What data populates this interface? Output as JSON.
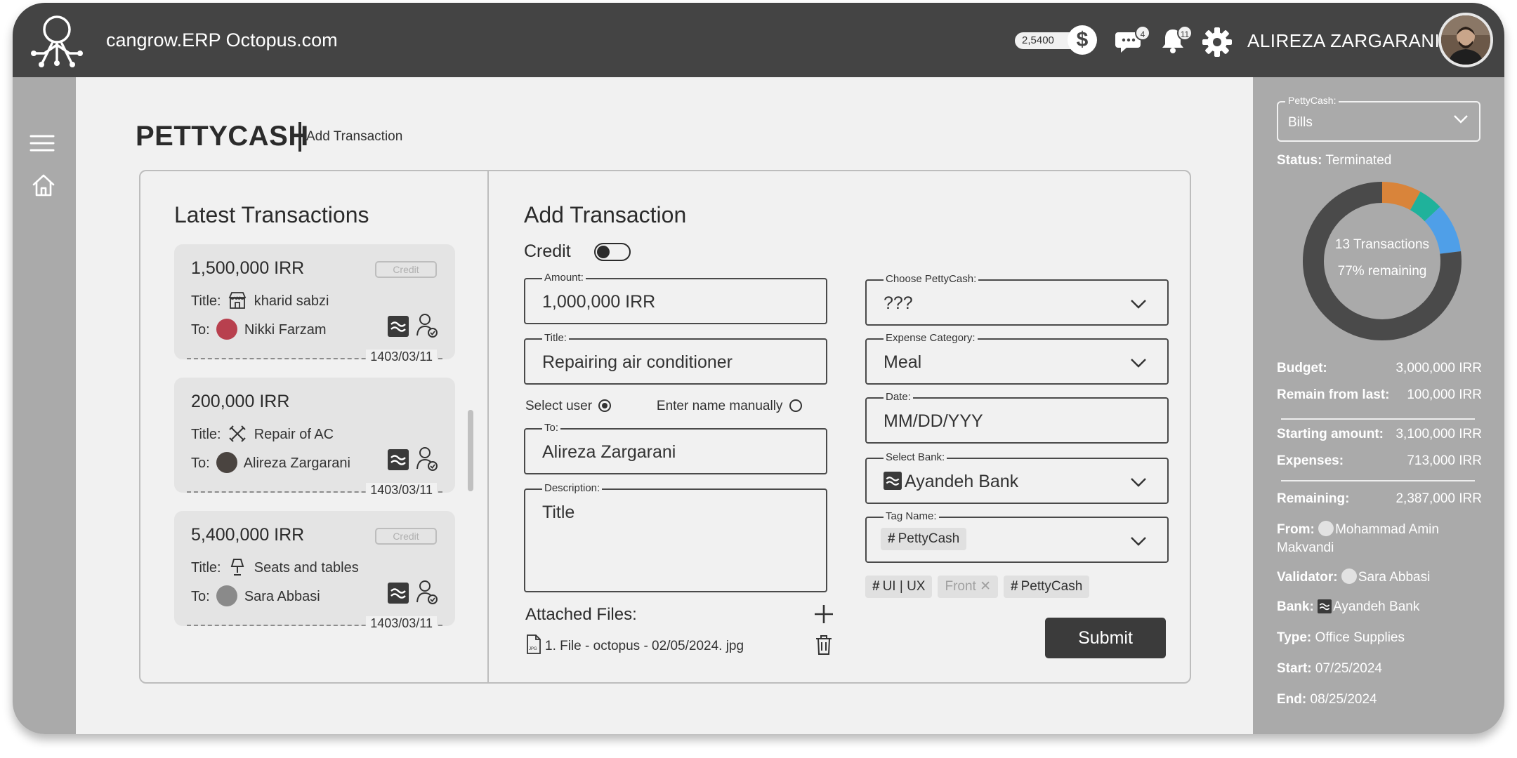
{
  "header": {
    "app_title": "cangrow.ERP Octopus.com",
    "balance": "2,5400",
    "messages_count": "4",
    "notifications_count": "11",
    "user_name": "ALIREZA ZARGARANI"
  },
  "page": {
    "title": "PETTYCASH",
    "subtitle": "Add Transaction"
  },
  "latest": {
    "title": "Latest Transactions",
    "items": [
      {
        "amount": "1,500,000 IRR",
        "badge": "Credit",
        "title_label": "Title:",
        "title": "kharid sabzi",
        "to_label": "To:",
        "to": "Nikki Farzam",
        "date": "1403/03/11",
        "title_icon": "store-icon",
        "avatar_color": "#b8404e"
      },
      {
        "amount": "200,000 IRR",
        "badge": "",
        "title_label": "Title:",
        "title": "Repair of AC",
        "to_label": "To:",
        "to": "Alireza Zargarani",
        "date": "1403/03/11",
        "title_icon": "tools-icon",
        "avatar_color": "#4a4440"
      },
      {
        "amount": "5,400,000 IRR",
        "badge": "Credit",
        "title_label": "Title:",
        "title": "Seats and tables",
        "to_label": "To:",
        "to": "Sara Abbasi",
        "date": "1403/03/11",
        "title_icon": "lamp-icon",
        "avatar_color": "#8a8a8a"
      }
    ]
  },
  "form": {
    "title": "Add Transaction",
    "credit_label": "Credit",
    "amount": {
      "label": "Amount:",
      "value": "1,000,000 IRR"
    },
    "title_field": {
      "label": "Title:",
      "value": "Repairing air conditioner"
    },
    "select_user_label": "Select user",
    "enter_manually_label": "Enter name manually",
    "to": {
      "label": "To:",
      "value": "Alireza Zargarani"
    },
    "description": {
      "label": "Description:",
      "value": "Title"
    },
    "pettycash": {
      "label": "Choose PettyCash:",
      "value": "???"
    },
    "category": {
      "label": "Expense Category:",
      "value": "Meal"
    },
    "date": {
      "label": "Date:",
      "value": "MM/DD/YYY"
    },
    "bank": {
      "label": "Select Bank:",
      "value": "Ayandeh Bank"
    },
    "tag": {
      "label": "Tag Name:",
      "value": "PettyCash"
    },
    "tags": [
      "UI | UX",
      "Front",
      "PettyCash"
    ],
    "attached_title": "Attached Files:",
    "file_name": "1. File - octopus - 02/05/2024. jpg",
    "submit_label": "Submit"
  },
  "sidebar": {
    "pettycash_label": "PettyCash:",
    "pettycash_value": "Bills",
    "status_label": "Status:",
    "status_value": "Terminated",
    "donut_line1": "13 Transactions",
    "donut_line2": "77% remaining",
    "donut_segments": [
      {
        "label": "orange",
        "fraction": 0.08,
        "color": "#d9843a"
      },
      {
        "label": "teal",
        "fraction": 0.05,
        "color": "#1fb29b"
      },
      {
        "label": "blue",
        "fraction": 0.1,
        "color": "#4f9fe8"
      },
      {
        "label": "remaining",
        "fraction": 0.77,
        "color": "#4a4a4a"
      }
    ],
    "budget_label": "Budget:",
    "budget_value": "3,000,000 IRR",
    "remain_label": "Remain from last:",
    "remain_value": "100,000 IRR",
    "starting_label": "Starting amount:",
    "starting_value": "3,100,000 IRR",
    "expenses_label": "Expenses:",
    "expenses_value": "713,000 IRR",
    "remaining_label": "Remaining:",
    "remaining_value": "2,387,000 IRR",
    "from_label": "From:",
    "from_value": "Mohammad Amin Makvandi",
    "validator_label": "Validator:",
    "validator_value": "Sara Abbasi",
    "bank_label": "Bank:",
    "bank_value": "Ayandeh Bank",
    "type_label": "Type:",
    "type_value": "Office Supplies",
    "start_label": "Start:",
    "start_value": "07/25/2024",
    "end_label": "End:",
    "end_value": "08/25/2024"
  }
}
